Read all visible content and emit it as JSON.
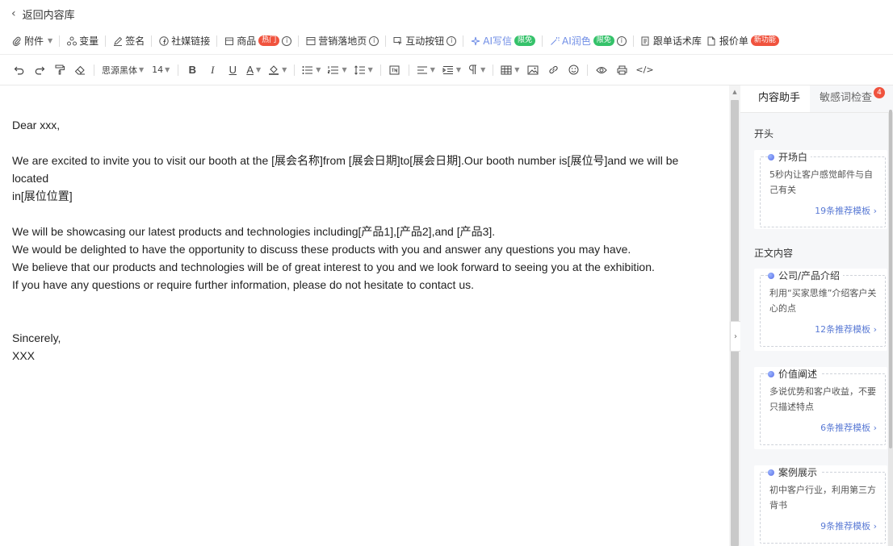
{
  "topbar": {
    "back_label": "返回内容库"
  },
  "toolbar1": {
    "attachment": "附件",
    "variable": "变量",
    "signature": "签名",
    "social_link": "社媒链接",
    "product": "商品",
    "product_badge": "热门",
    "landing_page": "营销落地页",
    "interactive_button": "互动按钮",
    "ai_write": "AI写信",
    "ai_write_badge": "限免",
    "ai_polish": "AI润色",
    "ai_polish_badge": "限免",
    "follow_up": "跟单话术库",
    "quote": "报价单",
    "quote_badge": "新功能"
  },
  "toolbar2": {
    "font_family": "思源黑体",
    "font_size": "14",
    "bold": "B",
    "italic": "I",
    "underline": "U",
    "text_color": "A",
    "code_block": "</>"
  },
  "editor": {
    "lines": [
      "Dear xxx,",
      "",
      "We are excited to invite you to visit our booth at the [展会名称]from [展会日期]to[展会日期].Our booth number is[展位号]and we will be located",
      "in[展位位置]",
      "",
      "We will be showcasing our latest products and technologies including[产品1],[产品2],and [产品3].",
      "We would be delighted to have the opportunity to discuss these products with you and answer any questions you may have.",
      "We believe that our products and technologies will be of great interest to you and we look forward to seeing you at the exhibition.",
      "If you have any questions or require further information, please do not hesitate to contact us.",
      "",
      "",
      "Sincerely,",
      "XXX"
    ]
  },
  "panel": {
    "tabs": [
      {
        "label": "内容助手"
      },
      {
        "label": "敏感词检查",
        "badge": "4"
      }
    ],
    "sections": [
      {
        "title": "开头",
        "cards": [
          {
            "title": "开场白",
            "desc": "5秒内让客户感觉邮件与自己有关",
            "link": "19条推荐模板"
          }
        ]
      },
      {
        "title": "正文内容",
        "cards": [
          {
            "title": "公司/产品介绍",
            "desc": "利用“买家思维”介绍客户关心的点",
            "link": "12条推荐模板"
          },
          {
            "title": "价值阐述",
            "desc": "多说优势和客户收益，不要只描述特点",
            "link": "6条推荐模板"
          },
          {
            "title": "案例展示",
            "desc": "初中客户行业，利用第三方背书",
            "link": "9条推荐模板"
          }
        ]
      }
    ]
  },
  "colors": {
    "badge_red": "#f0533e",
    "badge_green": "#35c26a",
    "ai_blue": "#6f8de6",
    "link_blue": "#5b7bd5"
  }
}
